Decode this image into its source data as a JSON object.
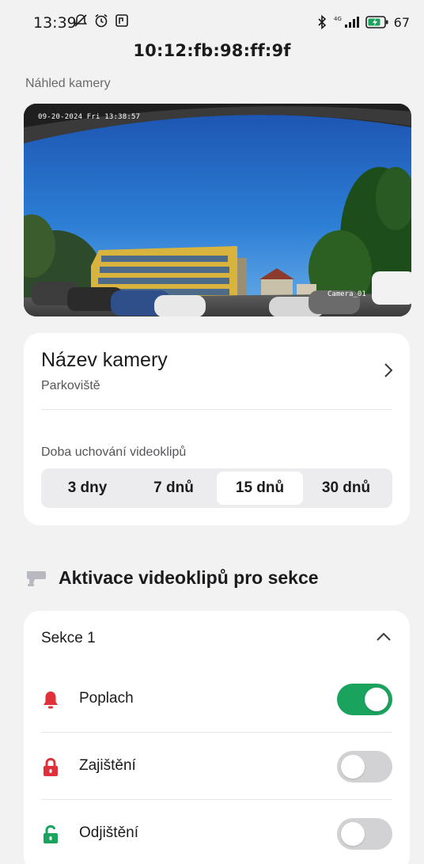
{
  "status_bar": {
    "time": "13:39",
    "battery_percent": "67",
    "network": "4G"
  },
  "header": {
    "title": "10:12:fb:98:ff:9f"
  },
  "preview": {
    "label": "Náhled kamery",
    "timestamp_overlay": "09-20-2024 Fri 13:38:57",
    "camera_overlay_name": "Camera_01"
  },
  "camera_name": {
    "title": "Název kamery",
    "value": "Parkoviště"
  },
  "retention": {
    "label": "Doba uchování videoklipů",
    "options": [
      "3 dny",
      "7 dnů",
      "15 dnů",
      "30 dnů"
    ],
    "selected": "15 dnů"
  },
  "sections": {
    "heading": "Aktivace videoklipů pro sekce",
    "section_title": "Sekce 1",
    "events": [
      {
        "label": "Poplach",
        "enabled": true,
        "icon": "bell-icon",
        "icon_color": "#e0303a"
      },
      {
        "label": "Zajištění",
        "enabled": false,
        "icon": "lock-closed-icon",
        "icon_color": "#e0303a"
      },
      {
        "label": "Odjištění",
        "enabled": false,
        "icon": "lock-open-icon",
        "icon_color": "#1aa35d"
      }
    ]
  },
  "colors": {
    "toggle_on": "#1aa35d",
    "toggle_off": "#d2d2d4",
    "background": "#f2f2f3",
    "card": "#ffffff"
  }
}
